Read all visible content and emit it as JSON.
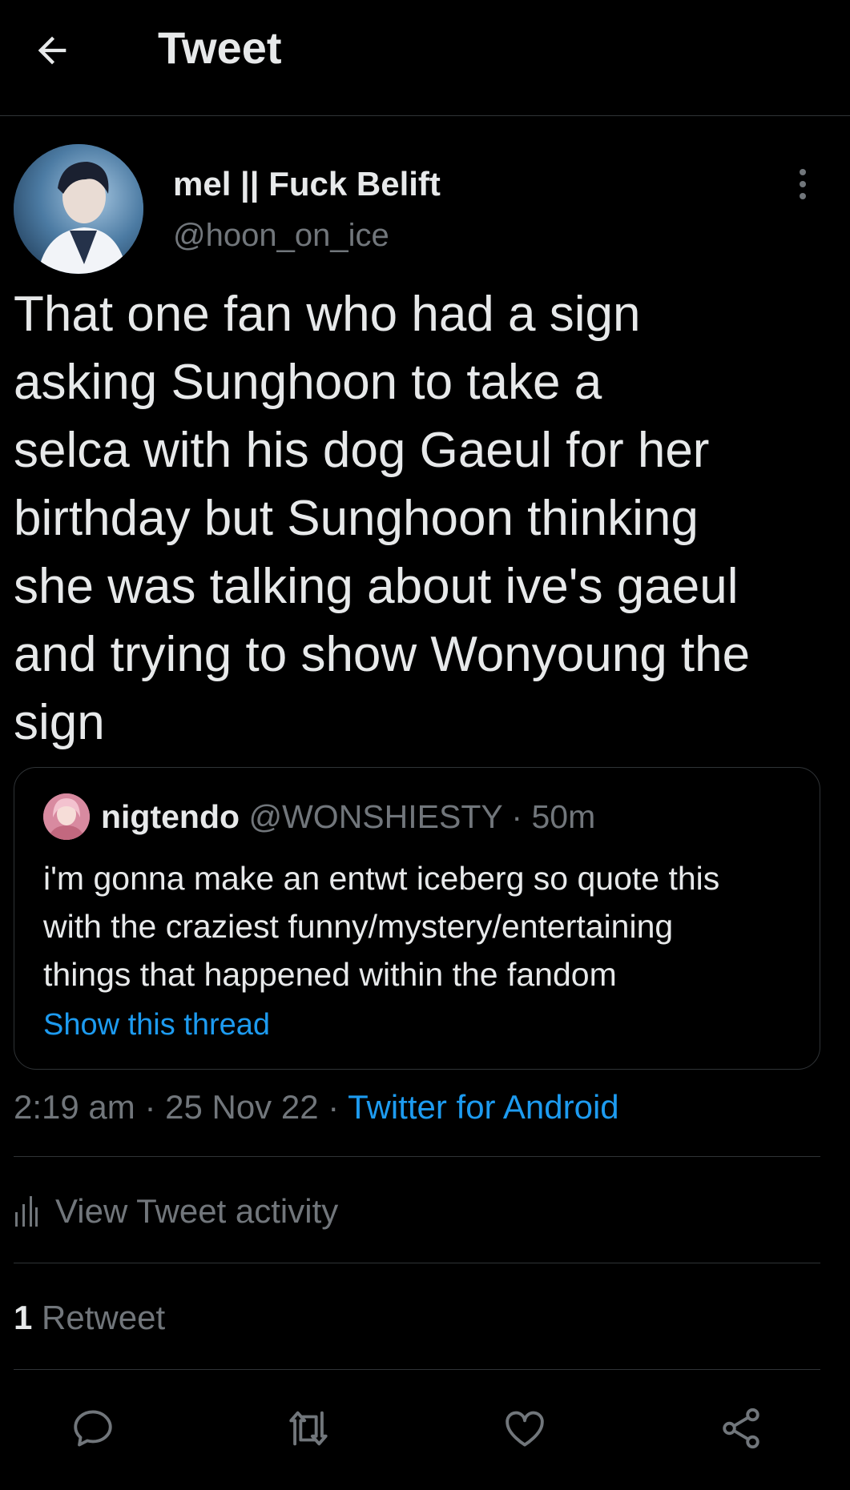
{
  "header": {
    "title": "Tweet",
    "back_icon": "arrow-left-icon"
  },
  "author": {
    "display_name": "mel || Fuck Belift",
    "handle": "@hoon_on_ice",
    "avatar_icon": "avatar"
  },
  "tweet": {
    "text": "That one fan who had a sign\nasking Sunghoon to take a\nselca with his dog Gaeul for her\nbirthday but Sunghoon thinking\nshe was talking about ive's gaeul\nand trying to show Wonyoung the\nsign"
  },
  "quote": {
    "name": "nigtendo",
    "handle": "@WONSHIESTY",
    "separator": "·",
    "time": "50m",
    "text": "i'm gonna make an entwt iceberg so quote this\nwith the craziest funny/mystery/entertaining\nthings that happened within the fandom",
    "show_thread": "Show this thread"
  },
  "meta": {
    "time": "2:19 am",
    "date": "25 Nov 22",
    "separator": "·",
    "source": "Twitter for Android"
  },
  "activity": {
    "label": "View Tweet activity"
  },
  "stats": {
    "retweet_count": "1",
    "retweet_label": "Retweet"
  },
  "actions": [
    "reply-icon",
    "retweet-icon",
    "like-icon",
    "share-icon"
  ],
  "colors": {
    "background": "#000000",
    "text_primary": "#e7e9ea",
    "text_secondary": "#71767b",
    "accent": "#1d9bf0",
    "border": "#2f3336"
  }
}
